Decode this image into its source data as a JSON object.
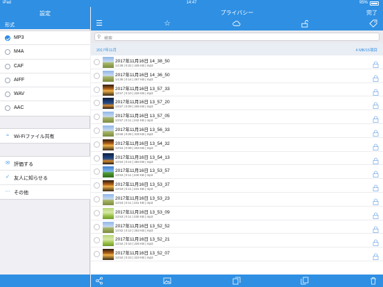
{
  "status": {
    "device": "iPad",
    "time": "14:47",
    "battery": "95%"
  },
  "settings": {
    "title": "設定",
    "section_format": "形式",
    "formats": [
      {
        "label": "MP3",
        "selected": true
      },
      {
        "label": "M4A",
        "selected": false
      },
      {
        "label": "CAF",
        "selected": false
      },
      {
        "label": "AIFF",
        "selected": false
      },
      {
        "label": "WAV",
        "selected": false
      },
      {
        "label": "AAC",
        "selected": false
      }
    ],
    "wifi": {
      "label": "Wi-Fiファイル共有",
      "icon": "wifi-icon"
    },
    "misc": [
      {
        "label": "評価する",
        "icon": "rate-icon"
      },
      {
        "label": "友人に知らせる",
        "icon": "share-friend-icon"
      },
      {
        "label": "その他",
        "icon": "more-dots-icon"
      }
    ]
  },
  "main": {
    "title": "プライバシー",
    "done_label": "完了",
    "toolbar_icons": [
      "list-icon",
      "star-icon",
      "cloud-icon",
      "unlock-icon",
      "tag-icon"
    ],
    "search_placeholder": "検索",
    "section": {
      "label": "2017年11月",
      "summary": "4 MB/15項目"
    },
    "recordings": [
      {
        "name": "2017年11月16日 14_38_50",
        "meta": "14:38 | 0:22 | 435 KB | mp3",
        "thumb": "field"
      },
      {
        "name": "2017年11月16日 14_36_50",
        "meta": "14:36 | 0:14 | 267 KB | mp3",
        "thumb": "field"
      },
      {
        "name": "2017年11月16日 13_57_33",
        "meta": "13:57 | 0:10 | 226 KB | mp3",
        "thumb": "sunset"
      },
      {
        "name": "2017年11月16日 13_57_20",
        "meta": "13:57 | 0:09 | 206 KB | mp3",
        "thumb": "night"
      },
      {
        "name": "2017年11月16日 13_57_05",
        "meta": "13:57 | 0:11 | 242 KB | mp3",
        "thumb": "field"
      },
      {
        "name": "2017年11月16日 13_56_33",
        "meta": "13:56 | 0:29 | 319 KB | mp3",
        "thumb": "field"
      },
      {
        "name": "2017年11月16日 13_54_32",
        "meta": "13:54 | 0:09 | 203 KB | mp3",
        "thumb": "sunset"
      },
      {
        "name": "2017年11月16日 13_54_13",
        "meta": "13:54 | 0:14 | 283 KB | mp3",
        "thumb": "night"
      },
      {
        "name": "2017年11月16日 13_53_57",
        "meta": "13:53 | 0:11 | 240 KB | mp3",
        "thumb": "tree"
      },
      {
        "name": "2017年11月16日 13_53_37",
        "meta": "13:53 | 0:11 | 231 KB | mp3",
        "thumb": "sunset"
      },
      {
        "name": "2017年11月16日 13_53_23",
        "meta": "13:53 | 0:11 | 231 KB | mp3",
        "thumb": "field"
      },
      {
        "name": "2017年11月16日 13_53_09",
        "meta": "13:53 | 0:11 | 230 KB | mp3",
        "thumb": "green"
      },
      {
        "name": "2017年11月16日 13_52_52",
        "meta": "13:52 | 0:12 | 253 KB | mp3",
        "thumb": "field"
      },
      {
        "name": "2017年11月16日 13_52_21",
        "meta": "13:52 | 0:10 | 226 KB | mp3",
        "thumb": "green"
      },
      {
        "name": "2017年11月16日 13_52_07",
        "meta": "13:52 | 0:10 | 223 KB | mp3",
        "thumb": "sunset"
      }
    ],
    "bottom_icons": [
      "share-icon",
      "image-icon",
      "move-out-icon",
      "move-in-icon",
      "trash-icon"
    ]
  },
  "colors": {
    "accent": "#2e8fe3",
    "background": "#efeff4"
  }
}
